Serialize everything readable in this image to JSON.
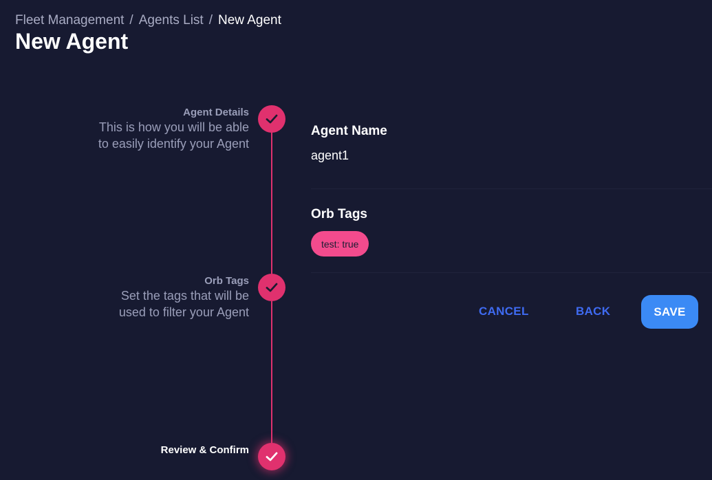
{
  "breadcrumb": {
    "items": [
      "Fleet Management",
      "Agents List"
    ],
    "separator": "/",
    "current": "New Agent"
  },
  "page_title": "New Agent",
  "stepper": {
    "steps": [
      {
        "title": "Agent Details",
        "description": [
          "This is how you will be able",
          "to easily identify your Agent"
        ],
        "status": "completed"
      },
      {
        "title": "Orb Tags",
        "description": [
          "Set the tags that will be",
          "used to filter your Agent"
        ],
        "status": "completed"
      },
      {
        "title": "Review & Confirm",
        "description": [],
        "status": "active"
      }
    ],
    "icon": "check-icon"
  },
  "review": {
    "agent_name_label": "Agent Name",
    "agent_name_value": "agent1",
    "orb_tags_label": "Orb Tags",
    "tags": [
      "test: true"
    ]
  },
  "actions": {
    "cancel_label": "CANCEL",
    "back_label": "BACK",
    "save_label": "SAVE"
  },
  "colors": {
    "background": "#171a31",
    "accent_pink": "#e0316e",
    "tag_pink": "#f34b8d",
    "link_blue": "#3f6bf2",
    "save_blue": "#3b8af5"
  }
}
